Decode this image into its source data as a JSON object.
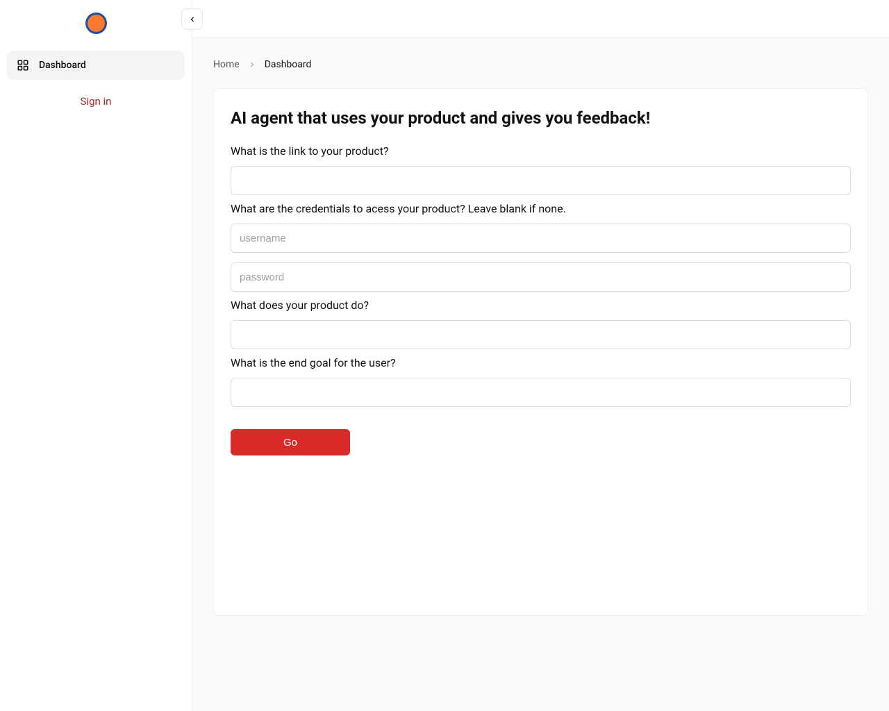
{
  "sidebar": {
    "items": [
      {
        "label": "Dashboard",
        "icon": "dashboard"
      }
    ],
    "signin": "Sign in"
  },
  "breadcrumb": {
    "home": "Home",
    "current": "Dashboard"
  },
  "card": {
    "title": "AI agent that uses your product and gives you feedback!",
    "q_link": "What is the link to your product?",
    "q_creds": "What are the credentials to acess your product? Leave blank if none.",
    "ph_username": "username",
    "ph_password": "password",
    "q_does": "What does your product do?",
    "q_goal": "What is the end goal for the user?",
    "go": "Go"
  }
}
